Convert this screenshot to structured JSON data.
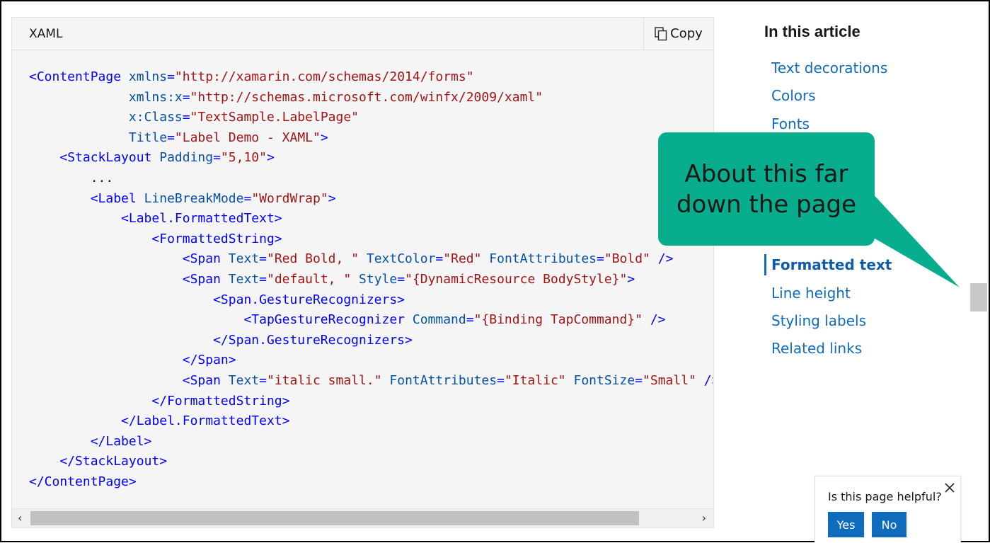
{
  "code_block": {
    "language": "XAML",
    "copy_label": "Copy",
    "lines": [
      [
        [
          "tag",
          "<ContentPage"
        ],
        [
          "plain",
          " "
        ],
        [
          "attr",
          "xmlns"
        ],
        [
          "punct",
          "="
        ],
        [
          "val",
          "\"http://xamarin.com/schemas/2014/forms\""
        ]
      ],
      [
        [
          "plain",
          "             "
        ],
        [
          "attr",
          "xmlns:x"
        ],
        [
          "punct",
          "="
        ],
        [
          "val",
          "\"http://schemas.microsoft.com/winfx/2009/xaml\""
        ]
      ],
      [
        [
          "plain",
          "             "
        ],
        [
          "attr",
          "x:Class"
        ],
        [
          "punct",
          "="
        ],
        [
          "val",
          "\"TextSample.LabelPage\""
        ]
      ],
      [
        [
          "plain",
          "             "
        ],
        [
          "attr",
          "Title"
        ],
        [
          "punct",
          "="
        ],
        [
          "val",
          "\"Label Demo - XAML\""
        ],
        [
          "tag",
          ">"
        ]
      ],
      [
        [
          "plain",
          "    "
        ],
        [
          "tag",
          "<StackLayout"
        ],
        [
          "plain",
          " "
        ],
        [
          "attr",
          "Padding"
        ],
        [
          "punct",
          "="
        ],
        [
          "val",
          "\"5,10\""
        ],
        [
          "tag",
          ">"
        ]
      ],
      [
        [
          "plain",
          "        ..."
        ]
      ],
      [
        [
          "plain",
          "        "
        ],
        [
          "tag",
          "<Label"
        ],
        [
          "plain",
          " "
        ],
        [
          "attr",
          "LineBreakMode"
        ],
        [
          "punct",
          "="
        ],
        [
          "val",
          "\"WordWrap\""
        ],
        [
          "tag",
          ">"
        ]
      ],
      [
        [
          "plain",
          "            "
        ],
        [
          "tag",
          "<Label.FormattedText>"
        ]
      ],
      [
        [
          "plain",
          "                "
        ],
        [
          "tag",
          "<FormattedString>"
        ]
      ],
      [
        [
          "plain",
          "                    "
        ],
        [
          "tag",
          "<Span"
        ],
        [
          "plain",
          " "
        ],
        [
          "attr",
          "Text"
        ],
        [
          "punct",
          "="
        ],
        [
          "val",
          "\"Red Bold, \""
        ],
        [
          "plain",
          " "
        ],
        [
          "attr",
          "TextColor"
        ],
        [
          "punct",
          "="
        ],
        [
          "val",
          "\"Red\""
        ],
        [
          "plain",
          " "
        ],
        [
          "attr",
          "FontAttributes"
        ],
        [
          "punct",
          "="
        ],
        [
          "val",
          "\"Bold\""
        ],
        [
          "plain",
          " "
        ],
        [
          "tag",
          "/>"
        ]
      ],
      [
        [
          "plain",
          "                    "
        ],
        [
          "tag",
          "<Span"
        ],
        [
          "plain",
          " "
        ],
        [
          "attr",
          "Text"
        ],
        [
          "punct",
          "="
        ],
        [
          "val",
          "\"default, \""
        ],
        [
          "plain",
          " "
        ],
        [
          "attr",
          "Style"
        ],
        [
          "punct",
          "="
        ],
        [
          "val",
          "\"{DynamicResource BodyStyle}\""
        ],
        [
          "tag",
          ">"
        ]
      ],
      [
        [
          "plain",
          "                        "
        ],
        [
          "tag",
          "<Span.GestureRecognizers>"
        ]
      ],
      [
        [
          "plain",
          "                            "
        ],
        [
          "tag",
          "<TapGestureRecognizer"
        ],
        [
          "plain",
          " "
        ],
        [
          "attr",
          "Command"
        ],
        [
          "punct",
          "="
        ],
        [
          "val",
          "\"{Binding TapCommand}\""
        ],
        [
          "plain",
          " "
        ],
        [
          "tag",
          "/>"
        ]
      ],
      [
        [
          "plain",
          "                        "
        ],
        [
          "tag",
          "</Span.GestureRecognizers>"
        ]
      ],
      [
        [
          "plain",
          "                    "
        ],
        [
          "tag",
          "</Span>"
        ]
      ],
      [
        [
          "plain",
          "                    "
        ],
        [
          "tag",
          "<Span"
        ],
        [
          "plain",
          " "
        ],
        [
          "attr",
          "Text"
        ],
        [
          "punct",
          "="
        ],
        [
          "val",
          "\"italic small.\""
        ],
        [
          "plain",
          " "
        ],
        [
          "attr",
          "FontAttributes"
        ],
        [
          "punct",
          "="
        ],
        [
          "val",
          "\"Italic\""
        ],
        [
          "plain",
          " "
        ],
        [
          "attr",
          "FontSize"
        ],
        [
          "punct",
          "="
        ],
        [
          "val",
          "\"Small\""
        ],
        [
          "plain",
          " "
        ],
        [
          "tag",
          "/>"
        ]
      ],
      [
        [
          "plain",
          "                "
        ],
        [
          "tag",
          "</FormattedString>"
        ]
      ],
      [
        [
          "plain",
          "            "
        ],
        [
          "tag",
          "</Label.FormattedText>"
        ]
      ],
      [
        [
          "plain",
          "        "
        ],
        [
          "tag",
          "</Label>"
        ]
      ],
      [
        [
          "plain",
          "    "
        ],
        [
          "tag",
          "</StackLayout>"
        ]
      ],
      [
        [
          "tag",
          "</ContentPage>"
        ]
      ]
    ]
  },
  "toc": {
    "title": "In this article",
    "items": [
      {
        "label": "Text decorations",
        "active": false
      },
      {
        "label": "Colors",
        "active": false
      },
      {
        "label": "Fonts",
        "active": false
      },
      {
        "label": "Formatted text",
        "active": true
      },
      {
        "label": "Line height",
        "active": false
      },
      {
        "label": "Styling labels",
        "active": false
      },
      {
        "label": "Related links",
        "active": false
      }
    ]
  },
  "callout": {
    "line1": "About this far",
    "line2": "down the page"
  },
  "feedback": {
    "question": "Is this page helpful?",
    "yes_label": "Yes",
    "no_label": "No"
  },
  "colors": {
    "link": "#0f6cbd",
    "callout": "#07ad8c",
    "tag": "#0101fd",
    "attr": "#0451a5",
    "value": "#a31515"
  },
  "icons": {
    "copy": "copy-icon",
    "close": "close-icon",
    "scroll_left": "chevron-left-icon",
    "scroll_right": "chevron-right-icon"
  }
}
